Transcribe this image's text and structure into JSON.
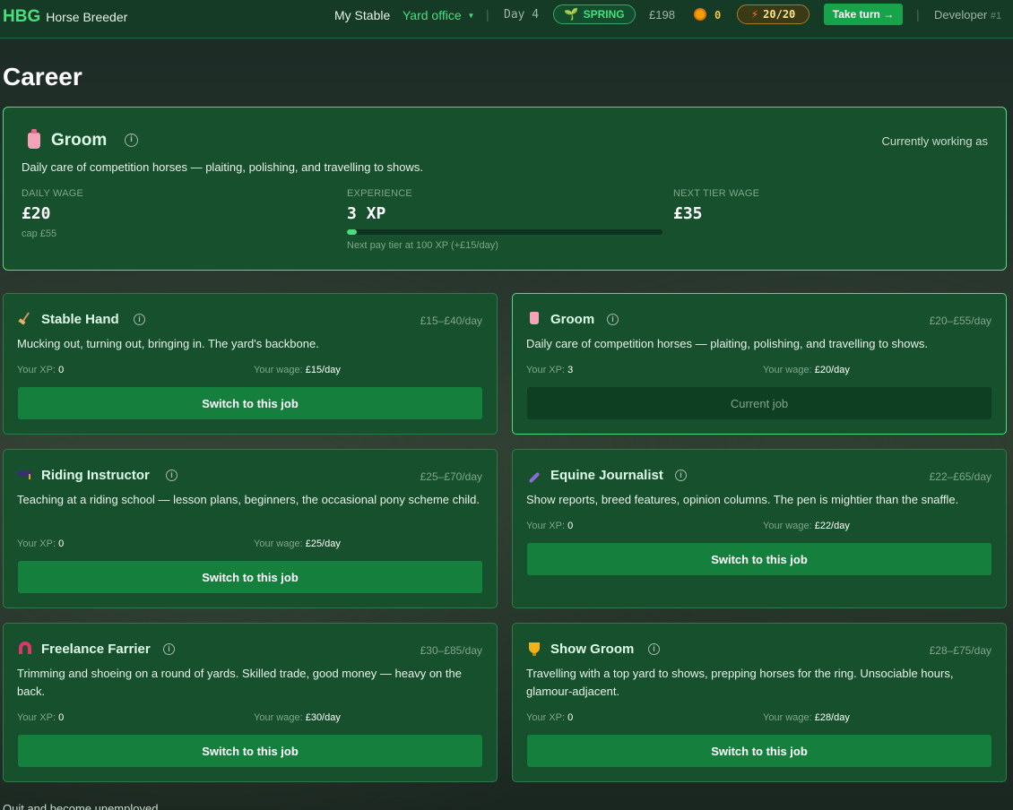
{
  "header": {
    "brand_abbr": "HBG",
    "brand_name": "Horse Breeder",
    "nav": {
      "my_stable": "My Stable",
      "yard_office": "Yard office"
    },
    "day": "Day 4",
    "season": "SPRING",
    "money": "£198",
    "coins": "0",
    "energy": "20/20",
    "take_turn": "Take turn →",
    "user": "Developer",
    "user_num": "#1"
  },
  "page": {
    "title": "Career"
  },
  "current_job": {
    "name": "Groom",
    "status": "Currently working as",
    "description": "Daily care of competition horses — plaiting, polishing, and travelling to shows.",
    "daily_wage_label": "DAILY WAGE",
    "daily_wage": "£20",
    "wage_cap": "cap £55",
    "experience_label": "EXPERIENCE",
    "experience": "3 XP",
    "xp_progress": 0.03,
    "next_tier_note": "Next pay tier at 100 XP (+£15/day)",
    "next_tier_label": "NEXT TIER WAGE",
    "next_tier_wage": "£35"
  },
  "jobs": [
    {
      "name": "Stable Hand",
      "icon": "broom-icon",
      "range": "£15–£40/day",
      "description": "Mucking out, turning out, bringing in. The yard's backbone.",
      "xp_label": "Your XP:",
      "xp": "0",
      "wage_label": "Your wage:",
      "wage": "£15/day",
      "button": "Switch to this job"
    },
    {
      "name": "Groom",
      "icon": "bottle-icon",
      "range": "£20–£55/day",
      "description": "Daily care of competition horses — plaiting, polishing, and travelling to shows.",
      "xp_label": "Your XP:",
      "xp": "3",
      "wage_label": "Your wage:",
      "wage": "£20/day",
      "button": "Current job"
    },
    {
      "name": "Riding Instructor",
      "icon": "graduation-cap-icon",
      "range": "£25–£70/day",
      "description": "Teaching at a riding school — lesson plans, beginners, the occasional pony scheme child.",
      "xp_label": "Your XP:",
      "xp": "0",
      "wage_label": "Your wage:",
      "wage": "£25/day",
      "button": "Switch to this job"
    },
    {
      "name": "Equine Journalist",
      "icon": "pen-icon",
      "range": "£22–£65/day",
      "description": "Show reports, breed features, opinion columns. The pen is mightier than the snaffle.",
      "xp_label": "Your XP:",
      "xp": "0",
      "wage_label": "Your wage:",
      "wage": "£22/day",
      "button": "Switch to this job"
    },
    {
      "name": "Freelance Farrier",
      "icon": "horseshoe-magnet-icon",
      "range": "£30–£85/day",
      "description": "Trimming and shoeing on a round of yards. Skilled trade, good money — heavy on the back.",
      "xp_label": "Your XP:",
      "xp": "0",
      "wage_label": "Your wage:",
      "wage": "£30/day",
      "button": "Switch to this job"
    },
    {
      "name": "Show Groom",
      "icon": "trophy-icon",
      "range": "£28–£75/day",
      "description": "Travelling with a top yard to shows, prepping horses for the ring. Unsociable hours, glamour-adjacent.",
      "xp_label": "Your XP:",
      "xp": "0",
      "wage_label": "Your wage:",
      "wage": "£28/day",
      "button": "Switch to this job"
    }
  ],
  "footer": {
    "quit": "Quit and become unemployed"
  }
}
